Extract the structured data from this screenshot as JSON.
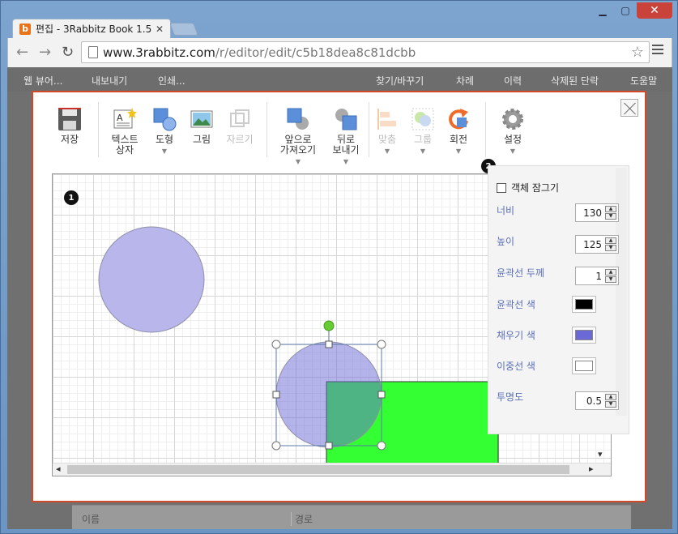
{
  "browser": {
    "tab_title": "편집 - 3Rabbitz Book 1.5",
    "favicon_letter": "b",
    "url_host": "www.3rabbitz.com",
    "url_path": "/r/editor/edit/c5b18dea8c81dcbb"
  },
  "appbar": {
    "items_left": [
      "웹 뷰어...",
      "내보내기",
      "인쇄..."
    ],
    "items_right": [
      "찾기/바꾸기",
      "차례",
      "이력",
      "삭제된 단락",
      "도움말"
    ]
  },
  "background_table": {
    "col1": "이름",
    "col2": "경로"
  },
  "toolbar": {
    "save": "저장",
    "textbox_1": "텍스트",
    "textbox_2": "상자",
    "shape": "도형",
    "image": "그림",
    "crop": "자르기",
    "bring_front_1": "앞으로",
    "bring_front_2": "가져오기",
    "send_back_1": "뒤로",
    "send_back_2": "보내기",
    "align": "맞춤",
    "group": "그룹",
    "rotate": "회전",
    "settings": "설정"
  },
  "badges": {
    "canvas": "1",
    "panel": "2"
  },
  "properties": {
    "lock_label": "객체 잠그기",
    "width_label": "너비",
    "width_value": "130",
    "height_label": "높이",
    "height_value": "125",
    "stroke_width_label": "윤곽선 두께",
    "stroke_width_value": "1",
    "stroke_color_label": "윤곽선 색",
    "stroke_color": "#000000",
    "fill_color_label": "채우기 색",
    "fill_color": "#6b69d6",
    "double_line_label": "이중선 색",
    "double_line_color": "#ffffff",
    "opacity_label": "투명도",
    "opacity_value": "0.5"
  },
  "colors": {
    "circle_fill": "#b8b6ea",
    "circle_stroke": "#8f8fa8",
    "rect_fill": "#33ff33",
    "overlap_fill": "#4dae7b",
    "handle_rotate": "#66cc33",
    "dialog_border": "#d2492a"
  },
  "icons": [
    "save-icon",
    "textbox-icon",
    "shape-icon",
    "image-icon",
    "crop-icon",
    "bring-front-icon",
    "send-back-icon",
    "align-icon",
    "group-icon",
    "rotate-icon",
    "settings-icon",
    "close-icon",
    "star-icon",
    "menu-icon"
  ]
}
